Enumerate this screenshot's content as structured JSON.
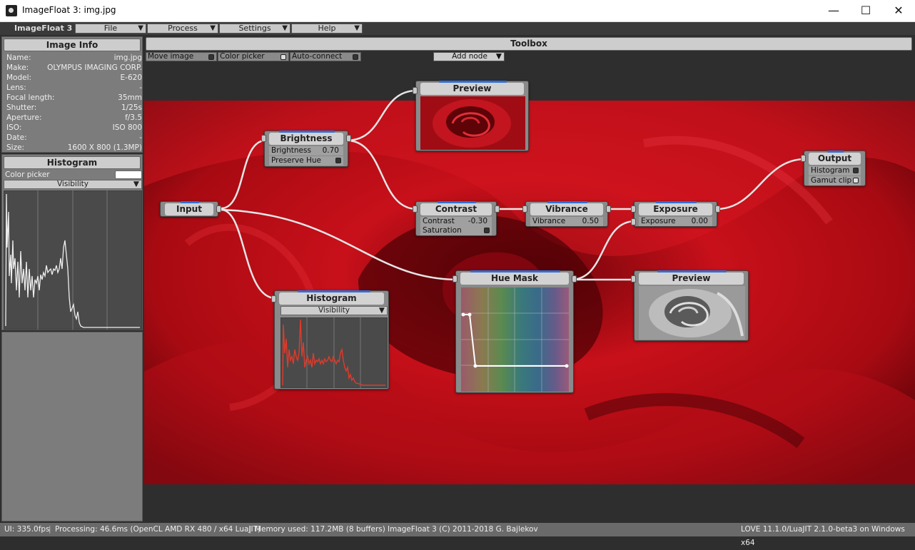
{
  "window": {
    "title": "ImageFloat 3: img.jpg",
    "minimize": "—",
    "maximize": "☐",
    "close": "✕"
  },
  "menubar": {
    "app_label": "ImageFloat 3",
    "items": [
      {
        "label": "File",
        "arrow": "▼"
      },
      {
        "label": "Process",
        "arrow": "▼"
      },
      {
        "label": "Settings",
        "arrow": "▼"
      },
      {
        "label": "Help",
        "arrow": "▼"
      }
    ]
  },
  "image_info": {
    "title": "Image Info",
    "rows": [
      {
        "k": "Name:",
        "v": "img.jpg"
      },
      {
        "k": "Make:",
        "v": "OLYMPUS IMAGING CORP."
      },
      {
        "k": "Model:",
        "v": "E-620"
      },
      {
        "k": "Lens:",
        "v": "-"
      },
      {
        "k": "Focal length:",
        "v": "35mm"
      },
      {
        "k": "Shutter:",
        "v": "1/25s"
      },
      {
        "k": "Aperture:",
        "v": "f/3.5"
      },
      {
        "k": "ISO:",
        "v": "ISO 800"
      },
      {
        "k": "Date:",
        "v": "-"
      },
      {
        "k": "Size:",
        "v": "1600 X 800 (1.3MP)"
      }
    ]
  },
  "histogram_panel": {
    "title": "Histogram",
    "color_picker_label": "Color picker",
    "visibility_label": "Visibility",
    "arrow": "▼"
  },
  "toolbox": {
    "title": "Toolbox",
    "move_image": "Move image",
    "color_picker": "Color picker",
    "auto_connect": "Auto-connect",
    "add_node": "Add node",
    "arrow": "▼"
  },
  "nodes": {
    "input": {
      "title": "Input"
    },
    "brightness": {
      "title": "Brightness",
      "param_label": "Brightness",
      "param_value": "0.70",
      "preserve_hue": "Preserve Hue"
    },
    "preview1": {
      "title": "Preview"
    },
    "contrast": {
      "title": "Contrast",
      "param_label": "Contrast",
      "param_value": "-0.30",
      "saturation": "Saturation"
    },
    "vibrance": {
      "title": "Vibrance",
      "param_label": "Vibrance",
      "param_value": "0.50"
    },
    "exposure": {
      "title": "Exposure",
      "param_label": "Exposure",
      "param_value": "0.00"
    },
    "output": {
      "title": "Output",
      "histogram": "Histogram",
      "gamut_clip": "Gamut clip"
    },
    "histogram": {
      "title": "Histogram",
      "visibility": "Visibility",
      "arrow": "▼"
    },
    "hue_mask": {
      "title": "Hue Mask"
    },
    "preview2": {
      "title": "Preview"
    }
  },
  "status": {
    "ui": "UI: 335.0fps",
    "processing": "Processing: 46.6ms (OpenCL AMD RX 480 / x64 LuaJIT)",
    "memory": "Memory used: 117.2MB (8 buffers)",
    "copyright": "ImageFloat 3 (C) 2011-2018 G. Bajlekov",
    "runtime": "LOVE 11.1.0/LuaJIT 2.1.0-beta3 on Windows x64"
  },
  "colors": {
    "accent": "#2f6fd6",
    "canvas_bg": "#2e2e2e",
    "panel_bg": "#7c7c7c",
    "rose": "#c8101a"
  }
}
